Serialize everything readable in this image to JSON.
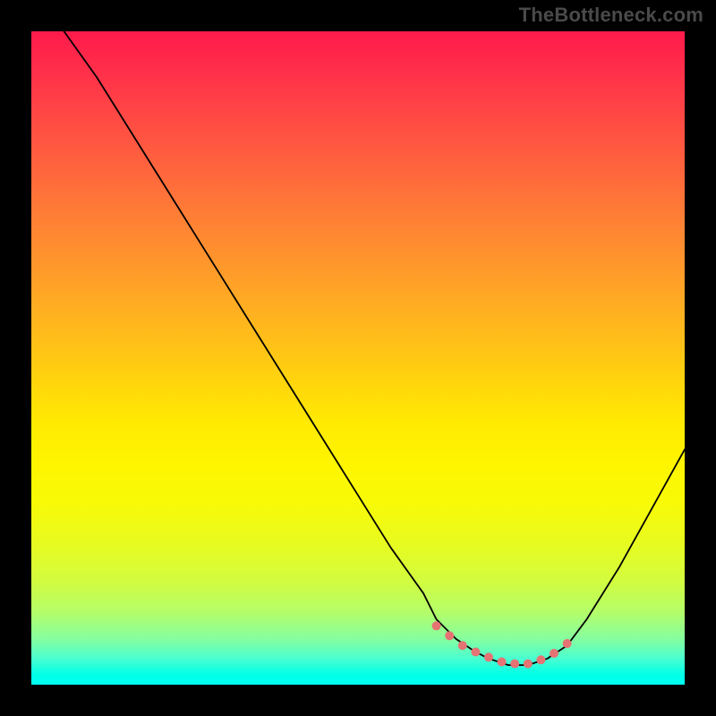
{
  "watermark": "TheBottleneck.com",
  "chart_data": {
    "type": "line",
    "title": "",
    "xlabel": "",
    "ylabel": "",
    "xlim": [
      0,
      100
    ],
    "ylim": [
      0,
      100
    ],
    "grid": false,
    "legend": false,
    "series": [
      {
        "name": "bottleneck-curve",
        "x": [
          5,
          10,
          15,
          20,
          25,
          30,
          35,
          40,
          45,
          50,
          55,
          60,
          62,
          65,
          68,
          70,
          73,
          76,
          79,
          82,
          85,
          90,
          95,
          100
        ],
        "values": [
          100,
          93,
          85,
          77,
          69,
          61,
          53,
          45,
          37,
          29,
          21,
          14,
          10,
          7,
          5,
          4,
          3,
          3,
          4,
          6,
          10,
          18,
          27,
          36
        ]
      }
    ],
    "markers": {
      "name": "optimal-range-markers",
      "color": "#e57373",
      "x": [
        62,
        64,
        66,
        68,
        70,
        72,
        74,
        76,
        78,
        80,
        82
      ],
      "values": [
        9,
        7.5,
        6,
        5,
        4.2,
        3.5,
        3.2,
        3.2,
        3.8,
        4.8,
        6.3
      ]
    },
    "background_gradient": {
      "top_color": "#ff1a4b",
      "mid_color": "#fff500",
      "bottom_color": "#00fff2"
    }
  }
}
